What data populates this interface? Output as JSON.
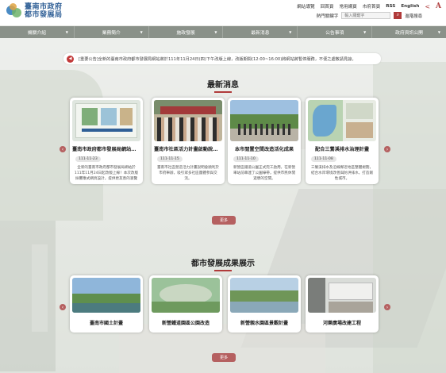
{
  "header": {
    "logo_line1": "臺南市政府",
    "logo_line2": "都市發展局",
    "links": [
      "網站導覽",
      "回首頁",
      "常用網頁",
      "市府首頁",
      "RSS",
      "English"
    ],
    "popular_label": "熱門關鍵字",
    "search_placeholder": "輸入關鍵字",
    "advanced_search": "進階搜尋"
  },
  "nav": {
    "items": [
      "機關介紹",
      "業務簡介",
      "施政發展",
      "最新消息",
      "公告事項",
      "政府資訊公開"
    ]
  },
  "announcement": {
    "text": "[重要公告]全新的臺南市政府都市發展局網站將於111年11月24日(四)下午改版上線，改版期間(12:00~16:00)將網站將暫停服務，不便之處敬請見諒。"
  },
  "news": {
    "title": "最新消息",
    "items": [
      {
        "title": "臺南市政府都市發展局網站改版",
        "date": "111-11-23",
        "desc": "全新的臺南市政府都市發展局網站於111年11月24日起改版上線！本次改版採響應式網頁設計，提供更友善的瀏覽體驗。"
      },
      {
        "title": "臺南市社區活力計畫啟動說明會",
        "date": "111-11-15",
        "desc": "臺南市社區營造活力計畫說明會順利於市府舉辦，吸引眾多社區團體參與交流。"
      },
      {
        "title": "本市閒置空間改造活化成果",
        "date": "111-11-10",
        "desc": "新營區鐵道公園正式完工啟用，在新營車站前串連了公園綠帶，提供市民休閒遊憩的空間。"
      },
      {
        "title": "配合三鶯溪排水治理計畫",
        "date": "111-11-08",
        "desc": "三鶯溪排水及沿線鄰近地區整體規劃，結合水岸環境改善與防洪排水，打造韌性城市。"
      }
    ]
  },
  "achievements": {
    "title": "都市發展成果展示",
    "items": [
      {
        "title": "臺南市國土計畫"
      },
      {
        "title": "新營鐵道園區公園改造"
      },
      {
        "title": "新營親水園區景觀計畫"
      },
      {
        "title": "河樂廣場改建工程"
      }
    ]
  },
  "more_label": "更多",
  "colors": {
    "accent": "#b03a3a",
    "nav": "#8a9189",
    "arrow": "#b56060",
    "title": "#2f5f96"
  }
}
